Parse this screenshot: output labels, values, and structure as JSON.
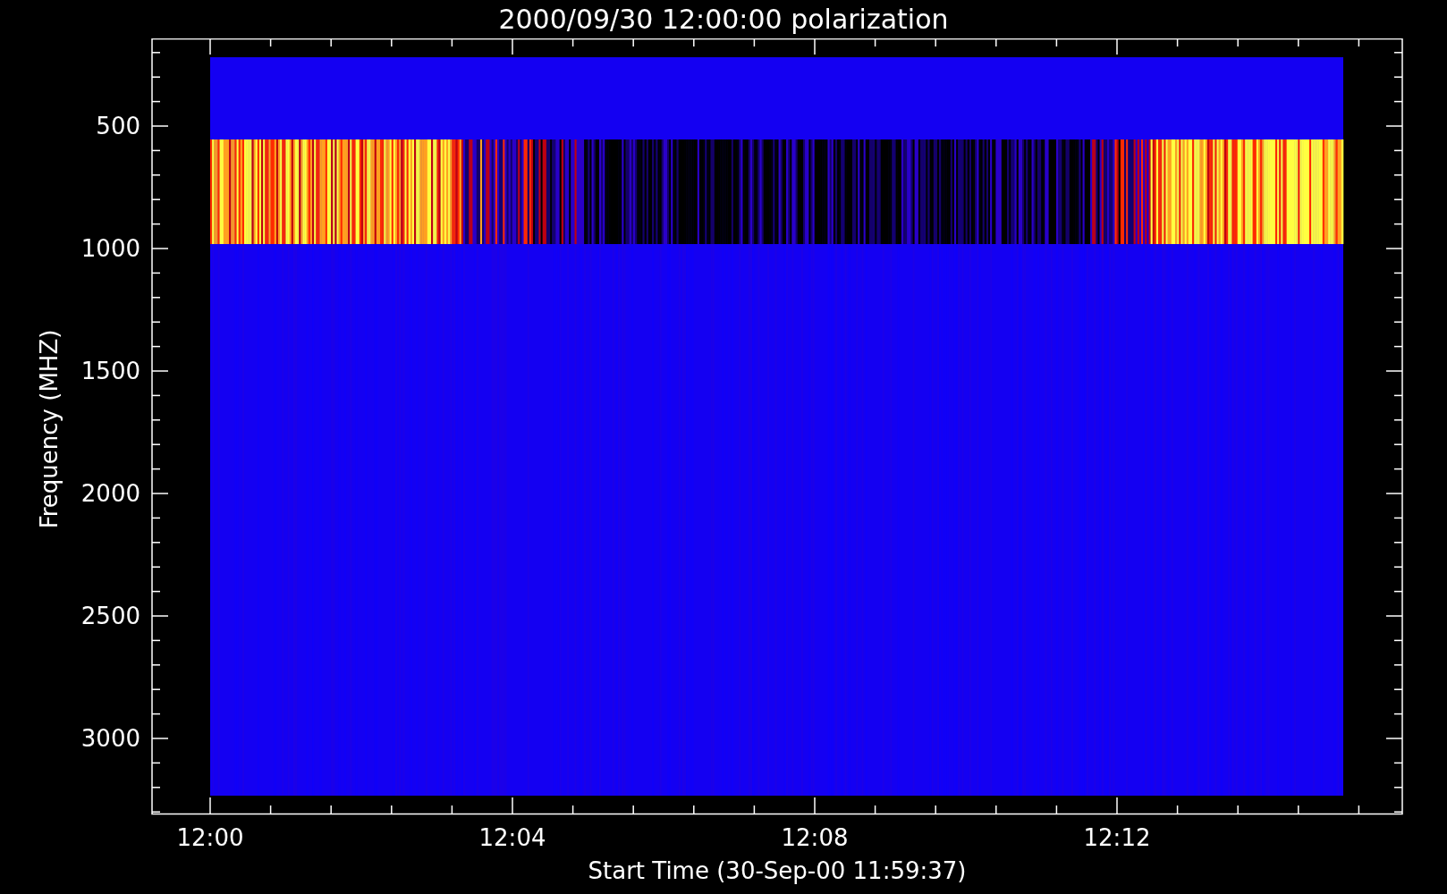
{
  "title": "2000/09/30 12:00:00 polarization",
  "y_axis": {
    "label": "Frequency (MHZ)",
    "ticks": [
      "500",
      "1000",
      "1500",
      "2000",
      "2500",
      "3000"
    ]
  },
  "x_axis": {
    "label": "Start Time (30-Sep-00 11:59:37)",
    "ticks": [
      "12:00",
      "12:04",
      "12:08",
      "12:12"
    ]
  }
}
